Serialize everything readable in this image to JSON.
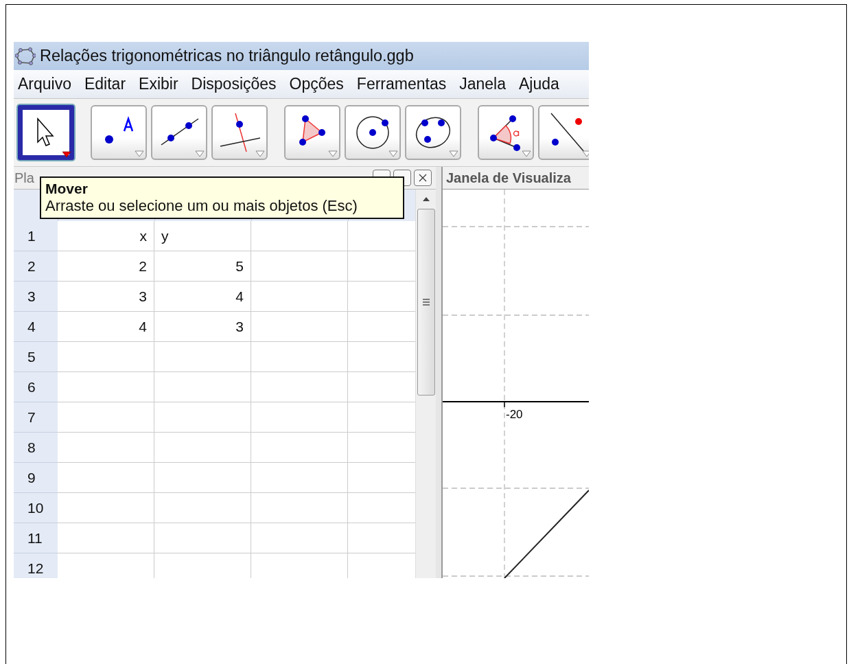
{
  "window": {
    "title": "Relações trigonométricas no triângulo retângulo.ggb"
  },
  "menu": [
    "Arquivo",
    "Editar",
    "Exibir",
    "Disposições",
    "Opções",
    "Ferramentas",
    "Janela",
    "Ajuda"
  ],
  "tool_groups": [
    {
      "tools": [
        {
          "kind": "move",
          "selected": true
        }
      ]
    },
    {
      "tools": [
        {
          "kind": "point",
          "selected": false
        },
        {
          "kind": "line",
          "selected": false
        },
        {
          "kind": "perpendicular",
          "selected": false
        }
      ]
    },
    {
      "tools": [
        {
          "kind": "polygon",
          "selected": false
        },
        {
          "kind": "circle",
          "selected": false
        },
        {
          "kind": "conic",
          "selected": false
        }
      ]
    },
    {
      "tools": [
        {
          "kind": "angle",
          "selected": false
        },
        {
          "kind": "reflect",
          "selected": false
        }
      ]
    }
  ],
  "spreadsheet": {
    "title": "Pla",
    "rows": [
      {
        "label": "1",
        "cells": [
          {
            "text": "x",
            "right_aligned": true
          },
          {
            "text": "y",
            "right_aligned": false
          }
        ]
      },
      {
        "label": "2",
        "cells": [
          {
            "text": "2",
            "right_aligned": true
          },
          {
            "text": "5",
            "right_aligned": true
          }
        ]
      },
      {
        "label": "3",
        "cells": [
          {
            "text": "3",
            "right_aligned": true
          },
          {
            "text": "4",
            "right_aligned": true
          }
        ]
      },
      {
        "label": "4",
        "cells": [
          {
            "text": "4",
            "right_aligned": true
          },
          {
            "text": "3",
            "right_aligned": true
          }
        ]
      },
      {
        "label": "5",
        "cells": []
      },
      {
        "label": "6",
        "cells": []
      },
      {
        "label": "7",
        "cells": []
      },
      {
        "label": "8",
        "cells": []
      },
      {
        "label": "9",
        "cells": []
      },
      {
        "label": "10",
        "cells": []
      },
      {
        "label": "11",
        "cells": []
      },
      {
        "label": "12",
        "cells": []
      }
    ]
  },
  "tooltip": {
    "title": "Mover",
    "text": "Arraste ou selecione um ou mais objetos (Esc)"
  },
  "graphics_view": {
    "title": "Janela de Visualiza",
    "axis_label": "-20"
  }
}
